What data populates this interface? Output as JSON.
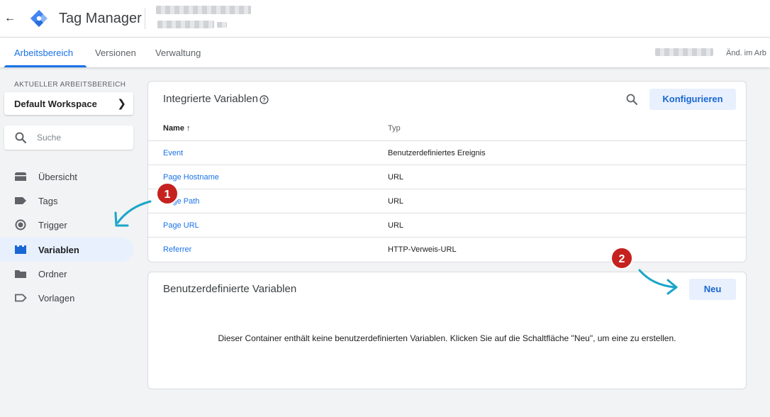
{
  "app": {
    "back_icon": "arrow-back-icon",
    "title": "Tag Manager",
    "logo": "tag-manager-logo",
    "colors": {
      "accent": "#1a73e8",
      "annotation": "#c5221f",
      "arrow": "#1aa5c9"
    }
  },
  "nav": {
    "tabs": [
      {
        "label": "Arbeitsbereich",
        "active": true
      },
      {
        "label": "Versionen",
        "active": false
      },
      {
        "label": "Verwaltung",
        "active": false
      }
    ],
    "changes_label": "Änd. im Arb"
  },
  "sidebar": {
    "workspace_heading": "AKTUELLER ARBEITSBEREICH",
    "workspace_name": "Default Workspace",
    "search_placeholder": "Suche",
    "items": [
      {
        "label": "Übersicht",
        "icon": "overview-icon",
        "active": false
      },
      {
        "label": "Tags",
        "icon": "tag-icon",
        "active": false
      },
      {
        "label": "Trigger",
        "icon": "trigger-icon",
        "active": false
      },
      {
        "label": "Variablen",
        "icon": "variables-icon",
        "active": true
      },
      {
        "label": "Ordner",
        "icon": "folder-icon",
        "active": false
      },
      {
        "label": "Vorlagen",
        "icon": "template-icon",
        "active": false
      }
    ]
  },
  "builtin": {
    "title": "Integrierte Variablen",
    "configure_label": "Konfigurieren",
    "columns": {
      "name": "Name ↑",
      "type": "Typ"
    },
    "rows": [
      {
        "name": "Event",
        "type": "Benutzerdefiniertes Ereignis"
      },
      {
        "name": "Page Hostname",
        "type": "URL"
      },
      {
        "name": "Page Path",
        "type": "URL"
      },
      {
        "name": "Page URL",
        "type": "URL"
      },
      {
        "name": "Referrer",
        "type": "HTTP-Verweis-URL"
      }
    ]
  },
  "custom": {
    "title": "Benutzerdefinierte Variablen",
    "new_label": "Neu",
    "empty_message": "Dieser Container enthält keine benutzerdefinierten Variablen. Klicken Sie auf die Schaltfläche \"Neu\", um eine zu erstellen."
  },
  "annotations": {
    "badge1": "1",
    "badge2": "2"
  }
}
